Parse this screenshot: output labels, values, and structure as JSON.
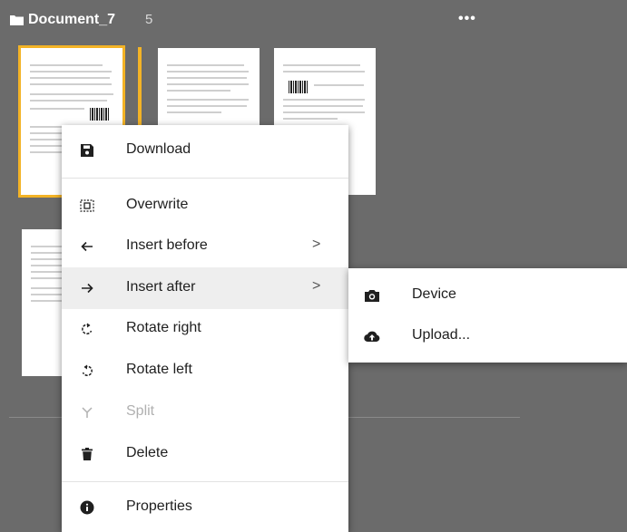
{
  "header": {
    "title": "Document_7",
    "page_count": "5",
    "more_label": "•••"
  },
  "pages": [
    {
      "name": "page-thumbnail-1",
      "selected": true
    },
    {
      "name": "page-thumbnail-2",
      "selected": false
    },
    {
      "name": "page-thumbnail-3",
      "selected": false
    },
    {
      "name": "page-thumbnail-4",
      "selected": false
    }
  ],
  "context_menu": {
    "items": [
      {
        "label": "Download",
        "icon": "save-icon"
      },
      {
        "label": "Overwrite",
        "icon": "overwrite-icon"
      },
      {
        "label": "Insert before",
        "icon": "arrow-left-icon",
        "has_submenu": true,
        "arrow": ">"
      },
      {
        "label": "Insert after",
        "icon": "arrow-right-icon",
        "has_submenu": true,
        "arrow": ">",
        "highlighted": true
      },
      {
        "label": "Rotate right",
        "icon": "rotate-right-icon"
      },
      {
        "label": "Rotate left",
        "icon": "rotate-left-icon"
      },
      {
        "label": "Split",
        "icon": "split-icon",
        "disabled": true
      },
      {
        "label": "Delete",
        "icon": "trash-icon"
      },
      {
        "label": "Properties",
        "icon": "info-icon"
      }
    ]
  },
  "submenu": {
    "items": [
      {
        "label": "Device",
        "icon": "camera-icon"
      },
      {
        "label": "Upload...",
        "icon": "cloud-upload-icon"
      }
    ]
  },
  "colors": {
    "accent": "#f3b326",
    "background": "#6b6b6b",
    "menu_bg": "#ffffff",
    "hover": "#eeeeee"
  }
}
